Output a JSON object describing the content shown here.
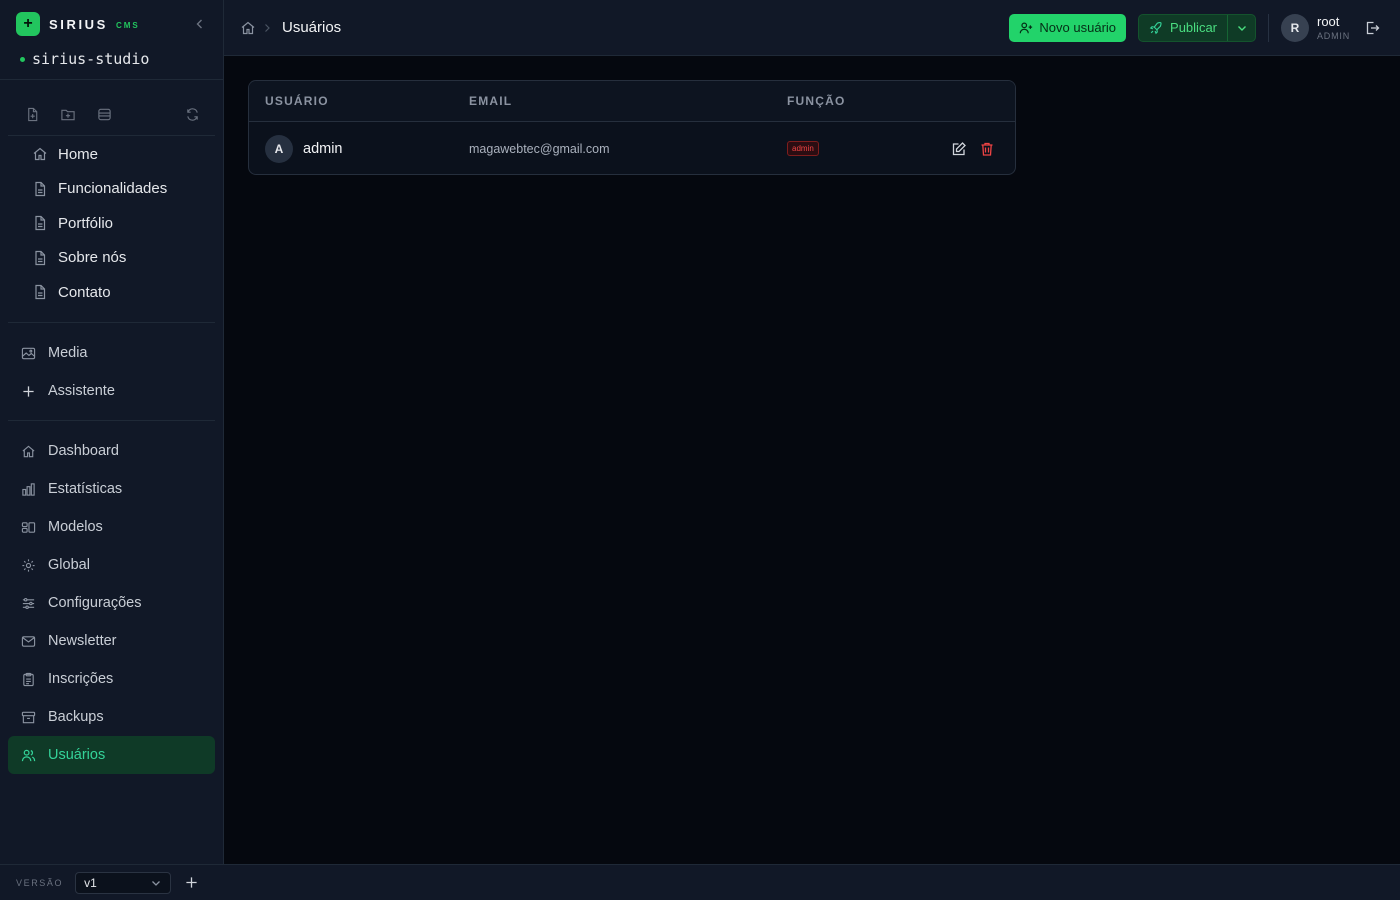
{
  "brand": {
    "name": "SIRIUS",
    "sub": "CMS"
  },
  "project": {
    "name": "sirius-studio"
  },
  "pages": [
    {
      "label": "Home",
      "icon": "home-icon"
    },
    {
      "label": "Funcionalidades",
      "icon": "file-icon"
    },
    {
      "label": "Portfólio",
      "icon": "file-icon"
    },
    {
      "label": "Sobre nós",
      "icon": "file-icon"
    },
    {
      "label": "Contato",
      "icon": "file-icon"
    }
  ],
  "tools_nav": [
    {
      "label": "Media",
      "icon": "image-icon"
    },
    {
      "label": "Assistente",
      "icon": "sparkle-icon"
    }
  ],
  "admin_nav": [
    {
      "label": "Dashboard",
      "icon": "home-icon"
    },
    {
      "label": "Estatísticas",
      "icon": "bar-chart-icon"
    },
    {
      "label": "Modelos",
      "icon": "models-icon"
    },
    {
      "label": "Global",
      "icon": "gear-icon"
    },
    {
      "label": "Configurações",
      "icon": "sliders-icon"
    },
    {
      "label": "Newsletter",
      "icon": "mail-icon"
    },
    {
      "label": "Inscrições",
      "icon": "clipboard-icon"
    },
    {
      "label": "Backups",
      "icon": "archive-icon"
    },
    {
      "label": "Usuários",
      "icon": "users-icon",
      "active": true
    }
  ],
  "footer": {
    "version_label": "VERSÃO",
    "version_value": "v1"
  },
  "header": {
    "breadcrumb_current": "Usuários",
    "new_user_label": "Novo usuário",
    "publish_label": "Publicar",
    "user": {
      "initial": "R",
      "name": "root",
      "role": "ADMIN"
    }
  },
  "table": {
    "columns": [
      "USUÁRIO",
      "EMAIL",
      "FUNÇÃO"
    ],
    "rows": [
      {
        "initial": "A",
        "user": "admin",
        "email": "magawebtec@gmail.com",
        "role": "admin"
      }
    ]
  },
  "colors": {
    "accent": "#22d36a",
    "active_bg": "#0f3a27",
    "danger": "#ef4444",
    "sidebar_bg": "#111827",
    "page_bg": "#05080f"
  }
}
